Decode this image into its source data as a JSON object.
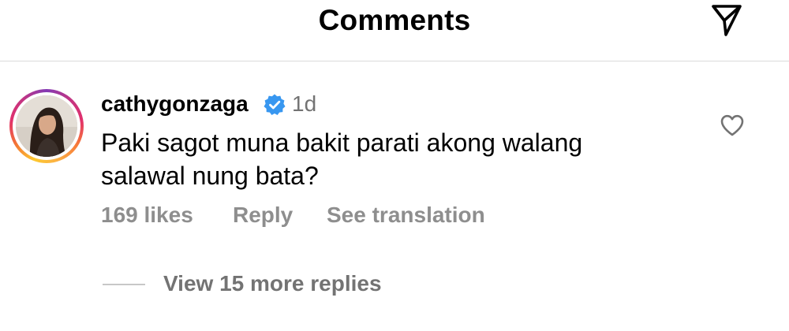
{
  "header": {
    "title": "Comments",
    "send_icon": "paper-plane-icon"
  },
  "comment": {
    "username": "cathygonzaga",
    "verified": true,
    "verified_icon": "verified-badge-icon",
    "verified_color": "#3897f0",
    "timestamp": "1d",
    "text": "Paki sagot muna bakit parati akong walang salawal nung bata?",
    "likes": "169 likes",
    "reply_label": "Reply",
    "translate_label": "See translation",
    "like_icon": "heart-icon",
    "avatar_ring_colors": [
      "#fdc830",
      "#f37335",
      "#e1306c",
      "#c13584",
      "#833ab4"
    ]
  },
  "replies": {
    "label": "View 15 more replies"
  }
}
